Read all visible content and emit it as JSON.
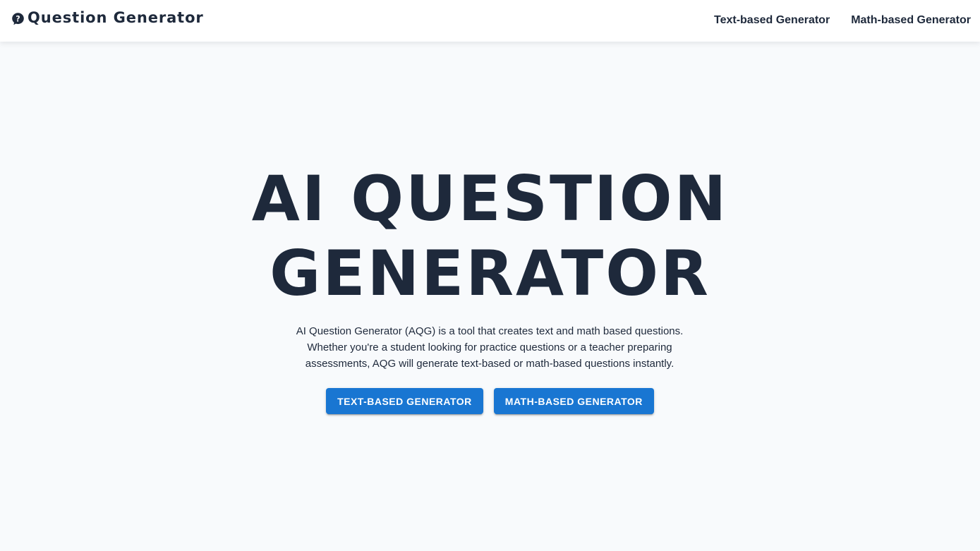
{
  "navbar": {
    "brand_icon": "question-circle-icon",
    "brand_text": "Question Generator",
    "links": [
      {
        "label": "Text-based Generator"
      },
      {
        "label": "Math-based Generator"
      }
    ]
  },
  "hero": {
    "title_line1": "AI QUESTION",
    "title_line2": "GENERATOR",
    "description": "AI Question Generator (AQG) is a tool that creates text and math based questions. Whether you're a student looking for practice questions or a teacher preparing assessments, AQG will generate text-based or math-based questions instantly.",
    "buttons": [
      {
        "label": "TEXT-BASED GENERATOR"
      },
      {
        "label": "MATH-BASED GENERATOR"
      }
    ]
  },
  "colors": {
    "background": "#f8fafc",
    "navbar_bg": "#ffffff",
    "text": "#1e293b",
    "accent": "#1976d2"
  }
}
